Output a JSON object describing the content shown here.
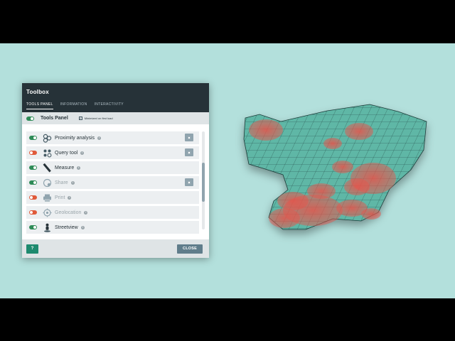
{
  "toolbox": {
    "title": "Toolbox",
    "tabs": [
      {
        "label": "TOOLS PANEL",
        "active": true
      },
      {
        "label": "INFORMATION",
        "active": false
      },
      {
        "label": "INTERACTIVITY",
        "active": false
      }
    ],
    "panel_label": "Tools Panel",
    "minimized_label": "Minimized on first load",
    "minimized_checked": true,
    "tools": [
      {
        "label": "Proximity analysis",
        "enabled": true,
        "icon": "proximity-icon",
        "has_settings": true
      },
      {
        "label": "Query tool",
        "enabled": false,
        "icon": "query-icon",
        "has_settings": true
      },
      {
        "label": "Measure",
        "enabled": true,
        "icon": "ruler-icon",
        "has_settings": false
      },
      {
        "label": "Share",
        "enabled": true,
        "icon": "share-icon",
        "has_settings": true
      },
      {
        "label": "Print",
        "enabled": false,
        "icon": "printer-icon",
        "has_settings": false
      },
      {
        "label": "Geolocation",
        "enabled": false,
        "icon": "crosshair-icon",
        "has_settings": false
      },
      {
        "label": "Streetview",
        "enabled": true,
        "icon": "pegman-icon",
        "has_settings": false
      }
    ],
    "help_label": "?",
    "close_label": "CLOSE"
  },
  "colors": {
    "header": "#263238",
    "accent": "#1e8a6f",
    "toggle_on": "#2e8b57",
    "toggle_off": "#e05a3a",
    "map_bg": "#b3e0dc",
    "map_fill": "#5fb7a6",
    "heat": "#e8534a"
  }
}
